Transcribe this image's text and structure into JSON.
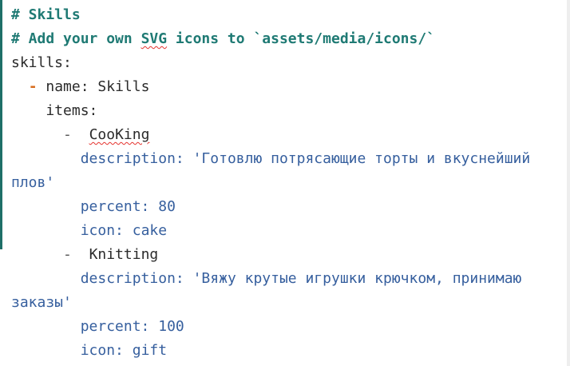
{
  "comments": {
    "line1": "# Skills",
    "line2_prefix": "# Add your own ",
    "line2_svg": "SVG",
    "line2_suffix": " icons to `assets/media/icons/`"
  },
  "yaml": {
    "skills_key": "skills:",
    "dash": "-",
    "name_key": "name:",
    "section_name": "Skills",
    "items_key": "items:",
    "items": [
      {
        "name": "CooKing",
        "description_key": "description:",
        "description_line1": "'Готовлю потрясающие торты и вкуснейший",
        "description_line2": "плов'",
        "percent_key": "percent:",
        "percent": "80",
        "icon_key": "icon:",
        "icon": "cake"
      },
      {
        "name": "Knitting",
        "description_key": "description:",
        "description_line1": "'Вяжу крутые игрушки крючком, принимаю",
        "description_line2": "заказы'",
        "percent_key": "percent:",
        "percent": "100",
        "icon_key": "icon:",
        "icon": "gift"
      }
    ]
  },
  "colors": {
    "comment": "#1f7a74",
    "accent_dash": "#d76c1e",
    "value_blue": "#365f9e",
    "text": "#2b2b2b",
    "left_bar": "#1f6f68"
  }
}
